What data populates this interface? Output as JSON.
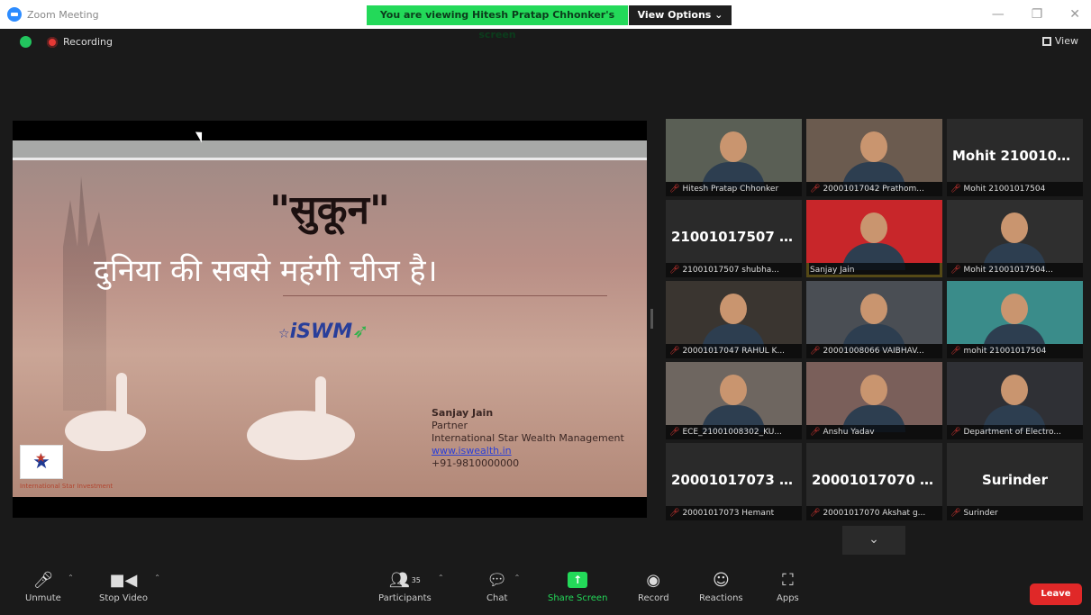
{
  "window": {
    "app_title": "Zoom Meeting",
    "viewing_banner": "You are viewing Hitesh Pratap Chhonker's screen",
    "view_options": "View Options ⌄"
  },
  "topbar": {
    "recording_label": "Recording",
    "view_label": "View"
  },
  "slide": {
    "quote": "\"सुकून\"",
    "subtitle": "दुनिया की सबसे महंगी चीज है।",
    "logo_text": "iSWM",
    "presenter_name": "Sanjay Jain",
    "presenter_role": "Partner",
    "presenter_org": "International Star Wealth Management",
    "presenter_site": "www.iswealth.in",
    "presenter_phone": "+91-9810000000",
    "org_tag": "International Star Investment"
  },
  "gallery": [
    {
      "big": "",
      "label": "Hitesh Pratap Chhonker",
      "muted": true,
      "video": true
    },
    {
      "big": "",
      "label": "20001017042 Prathom...",
      "muted": true,
      "video": true
    },
    {
      "big": "Mohit 2100101...",
      "label": "Mohit 21001017504",
      "muted": true,
      "video": false
    },
    {
      "big": "21001017507 s...",
      "label": "21001017507 shubha...",
      "muted": true,
      "video": false
    },
    {
      "big": "",
      "label": "Sanjay Jain",
      "muted": false,
      "video": true,
      "active": true
    },
    {
      "big": "",
      "label": "Mohit 21001017504...",
      "muted": true,
      "video": true
    },
    {
      "big": "",
      "label": "20001017047 RAHUL K...",
      "muted": true,
      "video": true
    },
    {
      "big": "",
      "label": "20001008066 VAIBHAV...",
      "muted": true,
      "video": true
    },
    {
      "big": "",
      "label": "mohit 21001017504",
      "muted": true,
      "video": true
    },
    {
      "big": "",
      "label": "ECE_21001008302_KU...",
      "muted": true,
      "video": true
    },
    {
      "big": "",
      "label": "Anshu Yadav",
      "muted": true,
      "video": true
    },
    {
      "big": "",
      "label": "Department of Electro...",
      "muted": true,
      "video": true
    },
    {
      "big": "20001017073 H...",
      "label": "20001017073 Hemant",
      "muted": true,
      "video": false
    },
    {
      "big": "20001017070 A...",
      "label": "20001017070 Akshat g...",
      "muted": true,
      "video": false
    },
    {
      "big": "Surinder",
      "label": "Surinder",
      "muted": true,
      "video": false
    }
  ],
  "toolbar": {
    "unmute": "Unmute",
    "stop_video": "Stop Video",
    "participants": "Participants",
    "participants_count": "35",
    "chat": "Chat",
    "share_screen": "Share Screen",
    "record": "Record",
    "reactions": "Reactions",
    "apps": "Apps",
    "leave": "Leave"
  },
  "colors": {
    "share_green": "#23d959",
    "leave_red": "#e02828",
    "active_speaker": "#f4d03f"
  }
}
